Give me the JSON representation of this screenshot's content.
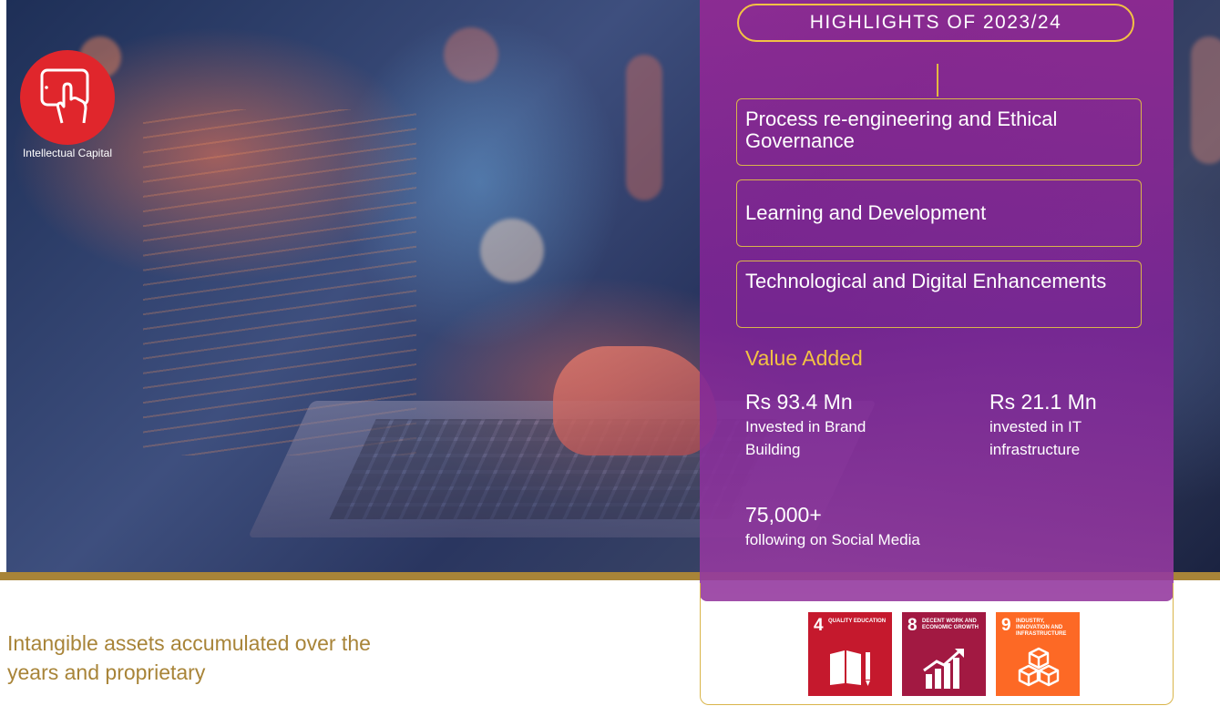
{
  "badge": {
    "label": "Intellectual Capital",
    "icon": "touch-tablet-icon",
    "color": "#e0262c"
  },
  "highlights": {
    "title": "HIGHLIGHTS OF 2023/24",
    "items": [
      "Process re-engineering and Ethical Governance",
      "Learning and Development",
      "Technological and Digital Enhancements"
    ]
  },
  "value_added": {
    "title": "Value Added",
    "stats": [
      {
        "value": "Rs 93.4 Mn",
        "desc": "Invested in Brand Building"
      },
      {
        "value": "Rs 21.1 Mn",
        "desc": "invested in IT infrastructure"
      },
      {
        "value": "75,000+",
        "desc": "following on Social Media"
      }
    ]
  },
  "sdgs": [
    {
      "number": "4",
      "label": "QUALITY EDUCATION",
      "color": "#c5192d",
      "icon": "book-pencil-icon"
    },
    {
      "number": "8",
      "label": "DECENT WORK AND ECONOMIC GROWTH",
      "color": "#a21942",
      "icon": "growth-chart-icon"
    },
    {
      "number": "9",
      "label": "INDUSTRY, INNOVATION AND INFRASTRUCTURE",
      "color": "#fd6925",
      "icon": "cubes-icon"
    }
  ],
  "intro_text": "Intangible assets accumulated over the years and proprietary",
  "colors": {
    "gold": "#a88438",
    "panel": "#8a2d98",
    "accent_yellow": "#f2c243"
  }
}
